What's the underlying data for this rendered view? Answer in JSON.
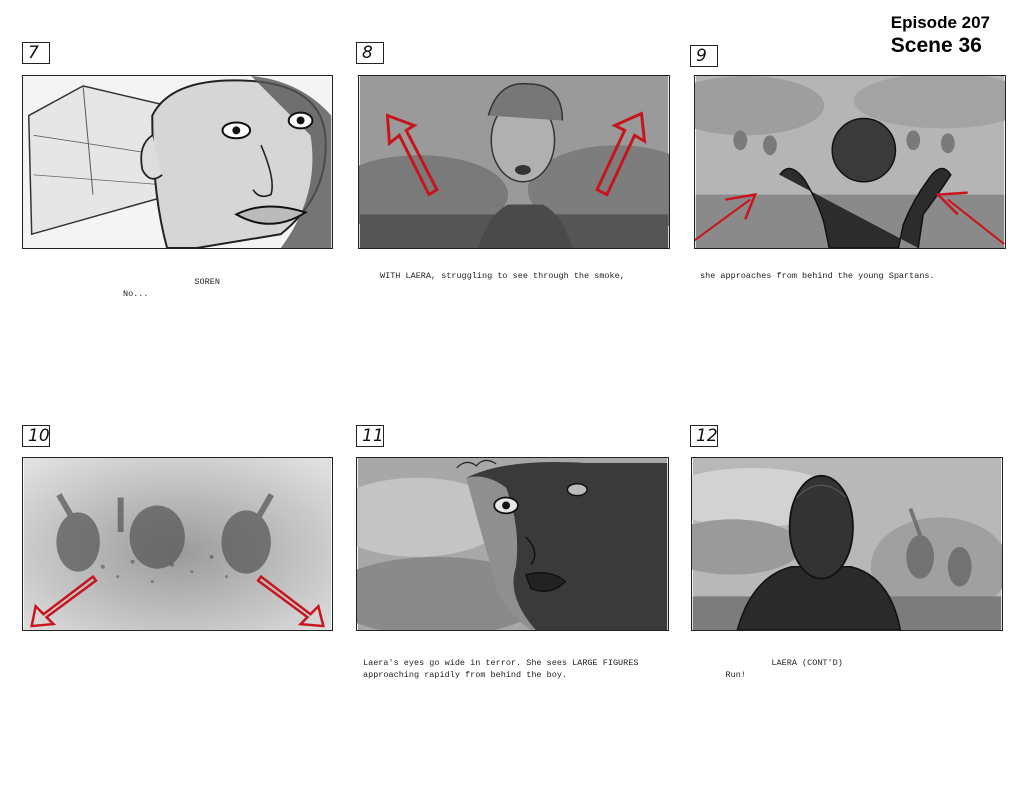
{
  "header": {
    "episode": "Episode 207",
    "scene": "Scene 36"
  },
  "panels": [
    {
      "number": "7",
      "caption_lines": [
        "              SOREN",
        "No..."
      ]
    },
    {
      "number": "8",
      "caption_lines": [
        "WITH LAERA, struggling to see through the smoke,"
      ]
    },
    {
      "number": "9",
      "caption_lines": [
        "she approaches from behind the young Spartans."
      ]
    },
    {
      "number": "10",
      "caption_lines": []
    },
    {
      "number": "11",
      "caption_lines": [
        "Laera's eyes go wide in terror. She sees LARGE FIGURES",
        "approaching rapidly from behind the boy."
      ]
    },
    {
      "number": "12",
      "caption_lines": [
        "              LAERA (CONT'D)",
        "     Run!"
      ]
    }
  ],
  "colors": {
    "arrow": "#c8141c",
    "ink": "#1a1a1a"
  }
}
